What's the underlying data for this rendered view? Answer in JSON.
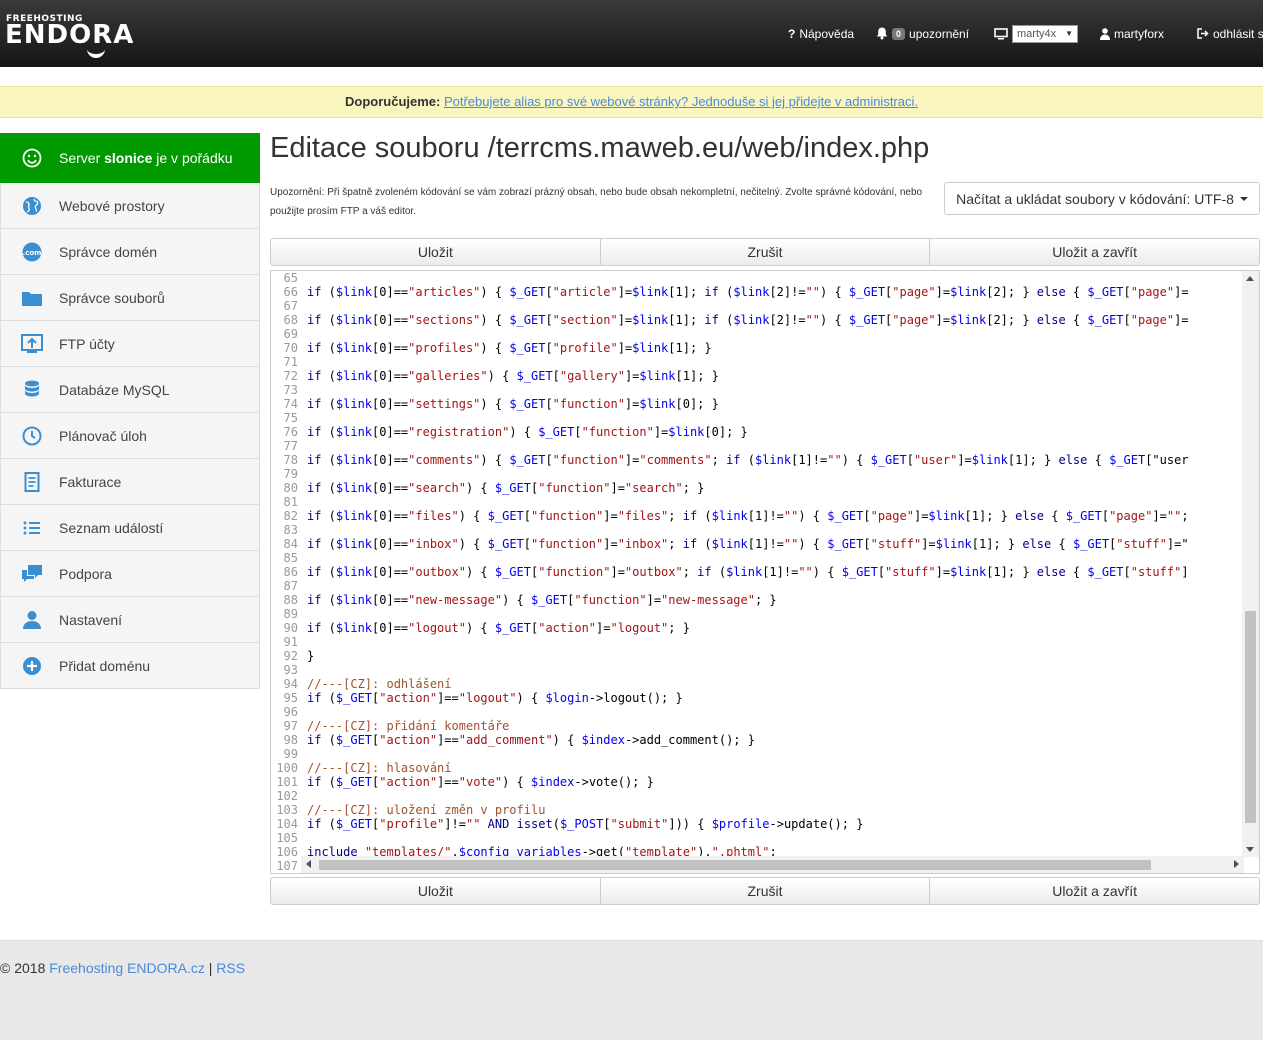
{
  "brand": {
    "small": "FREEHOSTING",
    "big": "ENDORA"
  },
  "nav": {
    "help_label": "Nápověda",
    "notifications_count": "0",
    "notifications_label": "upozornění",
    "account_select_value": "marty4x",
    "user_label": "martyforx",
    "logout_label": "odhlásit s"
  },
  "recommend": {
    "prefix": "Doporučujeme:",
    "link_text": "Potřebujete alias pro své webové stránky? Jednoduše si jej přidejte v administraci."
  },
  "sidebar": {
    "status": {
      "pre": "Server ",
      "server": "slonice",
      "post": " je v pořádku"
    },
    "items": [
      {
        "label": "Webové prostory",
        "icon": "globe-icon"
      },
      {
        "label": "Správce domén",
        "icon": "domain-icon"
      },
      {
        "label": "Správce souborů",
        "icon": "folder-icon"
      },
      {
        "label": "FTP účty",
        "icon": "ftp-upload-icon"
      },
      {
        "label": "Databáze MySQL",
        "icon": "database-icon"
      },
      {
        "label": "Plánovač úloh",
        "icon": "clock-icon"
      },
      {
        "label": "Fakturace",
        "icon": "invoice-icon"
      },
      {
        "label": "Seznam událostí",
        "icon": "list-icon"
      },
      {
        "label": "Podpora",
        "icon": "chat-icon"
      },
      {
        "label": "Nastavení",
        "icon": "user-icon"
      },
      {
        "label": "Přidat doménu",
        "icon": "plus-circle-icon"
      }
    ]
  },
  "main": {
    "title": "Editace souboru /terrcms.maweb.eu/web/index.php",
    "warning": "Upozornění: Při špatně zvoleném kódování se vám zobrazí prázný obsah, nebo bude obsah nekompletní, nečitelný. Zvolte správné kódování, nebo použijte prosím FTP a váš editor.",
    "encoding_button": "Načítat a ukládat soubory v kódování: UTF-8",
    "buttons": {
      "save": "Uložit",
      "cancel": "Zrušit",
      "save_close": "Uložit a zavřít"
    }
  },
  "editor": {
    "line_numbers": [
      "65",
      "66",
      "67",
      "68",
      "69",
      "70",
      "71",
      "72",
      "73",
      "74",
      "75",
      "76",
      "77",
      "78",
      "79",
      "80",
      "81",
      "82",
      "83",
      "84",
      "85",
      "86",
      "87",
      "88",
      "89",
      "90",
      "91",
      "92",
      "93",
      "94",
      "95",
      "96",
      "97",
      "98",
      "99",
      "100",
      "101",
      "102",
      "103",
      "104",
      "105",
      "106",
      "107"
    ],
    "lines": [
      "",
      "if ($link[0]==\"articles\") { $_GET[\"article\"]=$link[1]; if ($link[2]!=\"\") { $_GET[\"page\"]=$link[2]; } else { $_GET[\"page\"]=",
      "",
      "if ($link[0]==\"sections\") { $_GET[\"section\"]=$link[1]; if ($link[2]!=\"\") { $_GET[\"page\"]=$link[2]; } else { $_GET[\"page\"]=",
      "",
      "if ($link[0]==\"profiles\") { $_GET[\"profile\"]=$link[1]; }",
      "",
      "if ($link[0]==\"galleries\") { $_GET[\"gallery\"]=$link[1]; }",
      "",
      "if ($link[0]==\"settings\") { $_GET[\"function\"]=$link[0]; }",
      "",
      "if ($link[0]==\"registration\") { $_GET[\"function\"]=$link[0]; }",
      "",
      "if ($link[0]==\"comments\") { $_GET[\"function\"]=\"comments\"; if ($link[1]!=\"\") { $_GET[\"user\"]=$link[1]; } else { $_GET[\"user",
      "",
      "if ($link[0]==\"search\") { $_GET[\"function\"]=\"search\"; }",
      "",
      "if ($link[0]==\"files\") { $_GET[\"function\"]=\"files\"; if ($link[1]!=\"\") { $_GET[\"page\"]=$link[1]; } else { $_GET[\"page\"]=\"\";",
      "",
      "if ($link[0]==\"inbox\") { $_GET[\"function\"]=\"inbox\"; if ($link[1]!=\"\") { $_GET[\"stuff\"]=$link[1]; } else { $_GET[\"stuff\"]=\"",
      "",
      "if ($link[0]==\"outbox\") { $_GET[\"function\"]=\"outbox\"; if ($link[1]!=\"\") { $_GET[\"stuff\"]=$link[1]; } else { $_GET[\"stuff\"]",
      "",
      "if ($link[0]==\"new-message\") { $_GET[\"function\"]=\"new-message\"; }",
      "",
      "if ($link[0]==\"logout\") { $_GET[\"action\"]=\"logout\"; }",
      "",
      "}",
      "",
      "//---[CZ]: odhlášení",
      "if ($_GET[\"action\"]==\"logout\") { $login->logout(); }",
      "",
      "//---[CZ]: přidání komentáře",
      "if ($_GET[\"action\"]==\"add_comment\") { $index->add_comment(); }",
      "",
      "//---[CZ]: hlasování",
      "if ($_GET[\"action\"]==\"vote\") { $index->vote(); }",
      "",
      "//---[CZ]: uložení změn v profilu",
      "if ($_GET[\"profile\"]!=\"\" AND isset($_POST[\"submit\"])) { $profile->update(); }",
      "",
      "include \"templates/\".$config_variables->get(\"template\").\".phtml\";",
      ""
    ]
  },
  "footer": {
    "copyright": "© 2018",
    "brand_link": "Freehosting ENDORA.cz",
    "separator": "|",
    "rss_link": "RSS"
  },
  "colors": {
    "status_green": "#009900",
    "link_blue": "#4a89dc",
    "reco_bg": "#f9f7bf",
    "sidebar_icon": "#3b8fd0",
    "code_string": "#a31515",
    "code_var": "#0000ee",
    "code_keyword": "#00008b",
    "code_comment": "#a0522d"
  }
}
